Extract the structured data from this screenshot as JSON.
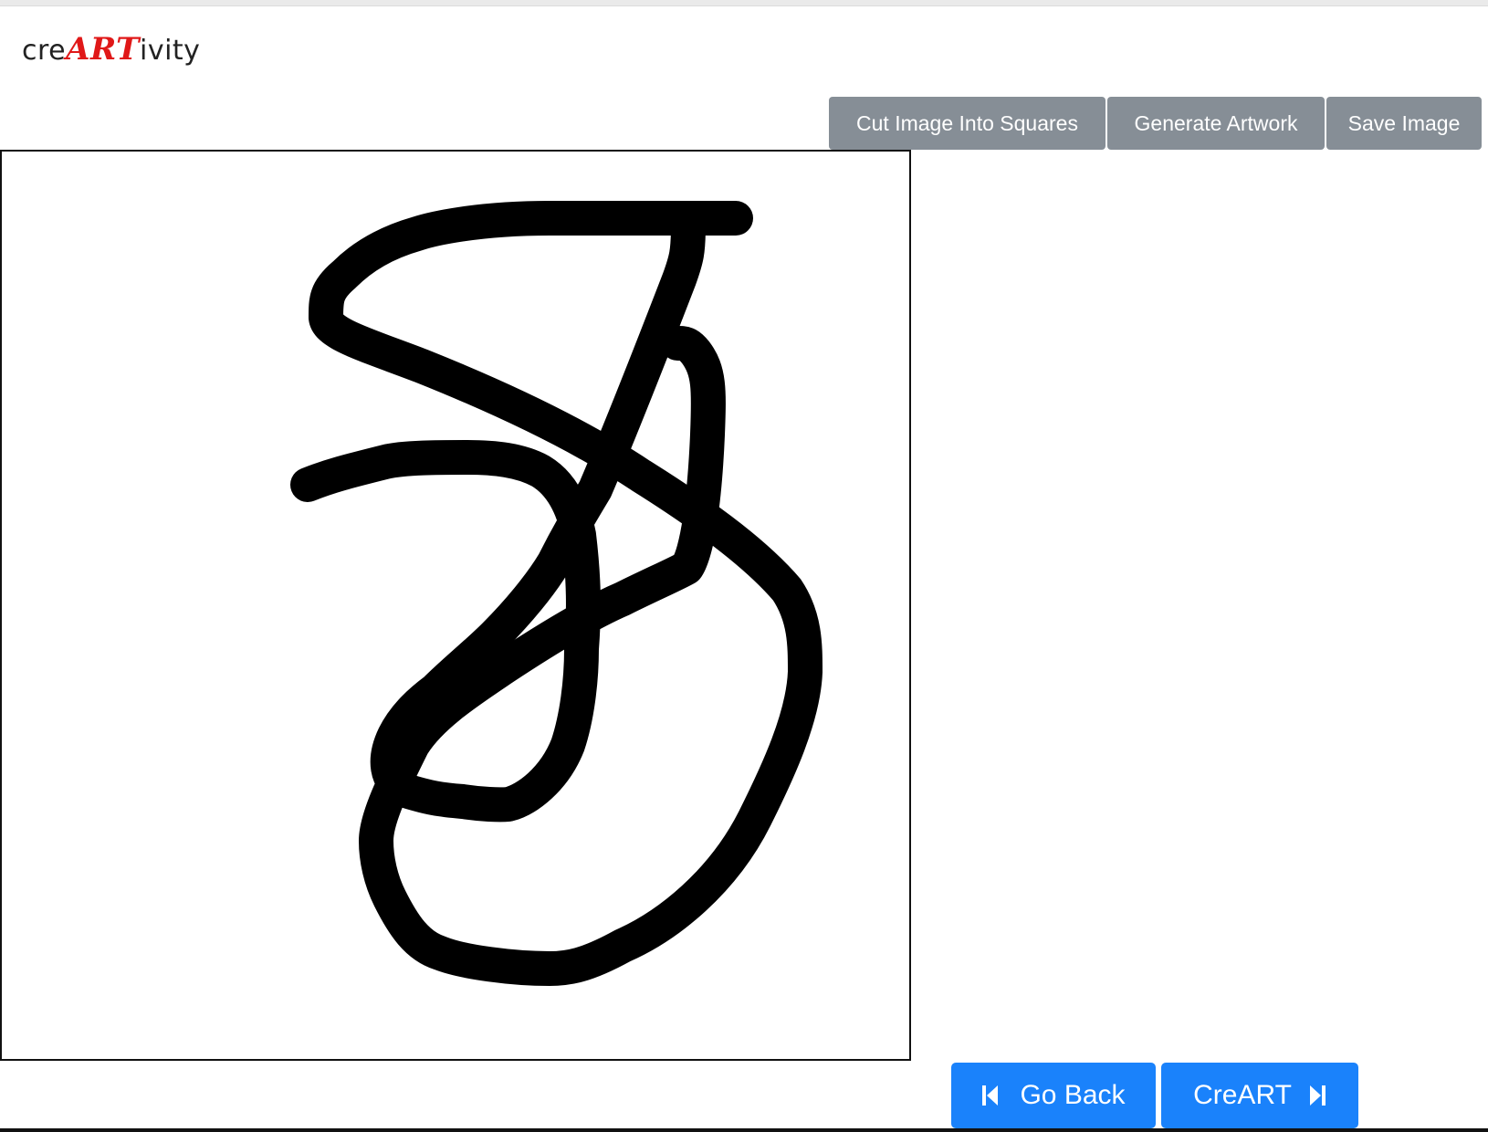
{
  "brand": {
    "prefix": "cre",
    "accent": "ART",
    "suffix": "ivity",
    "accent_color": "#e01818"
  },
  "toolbar": {
    "cut_label": "Cut Image Into Squares",
    "generate_label": "Generate Artwork",
    "save_label": "Save Image",
    "button_color": "#868e96"
  },
  "canvas": {
    "stroke_color": "#000000",
    "background": "#ffffff"
  },
  "navigation": {
    "back_label": "Go Back",
    "back_icon": "skip-back-icon",
    "next_label": "CreART",
    "next_icon": "skip-forward-icon",
    "button_color": "#1a82fb"
  }
}
